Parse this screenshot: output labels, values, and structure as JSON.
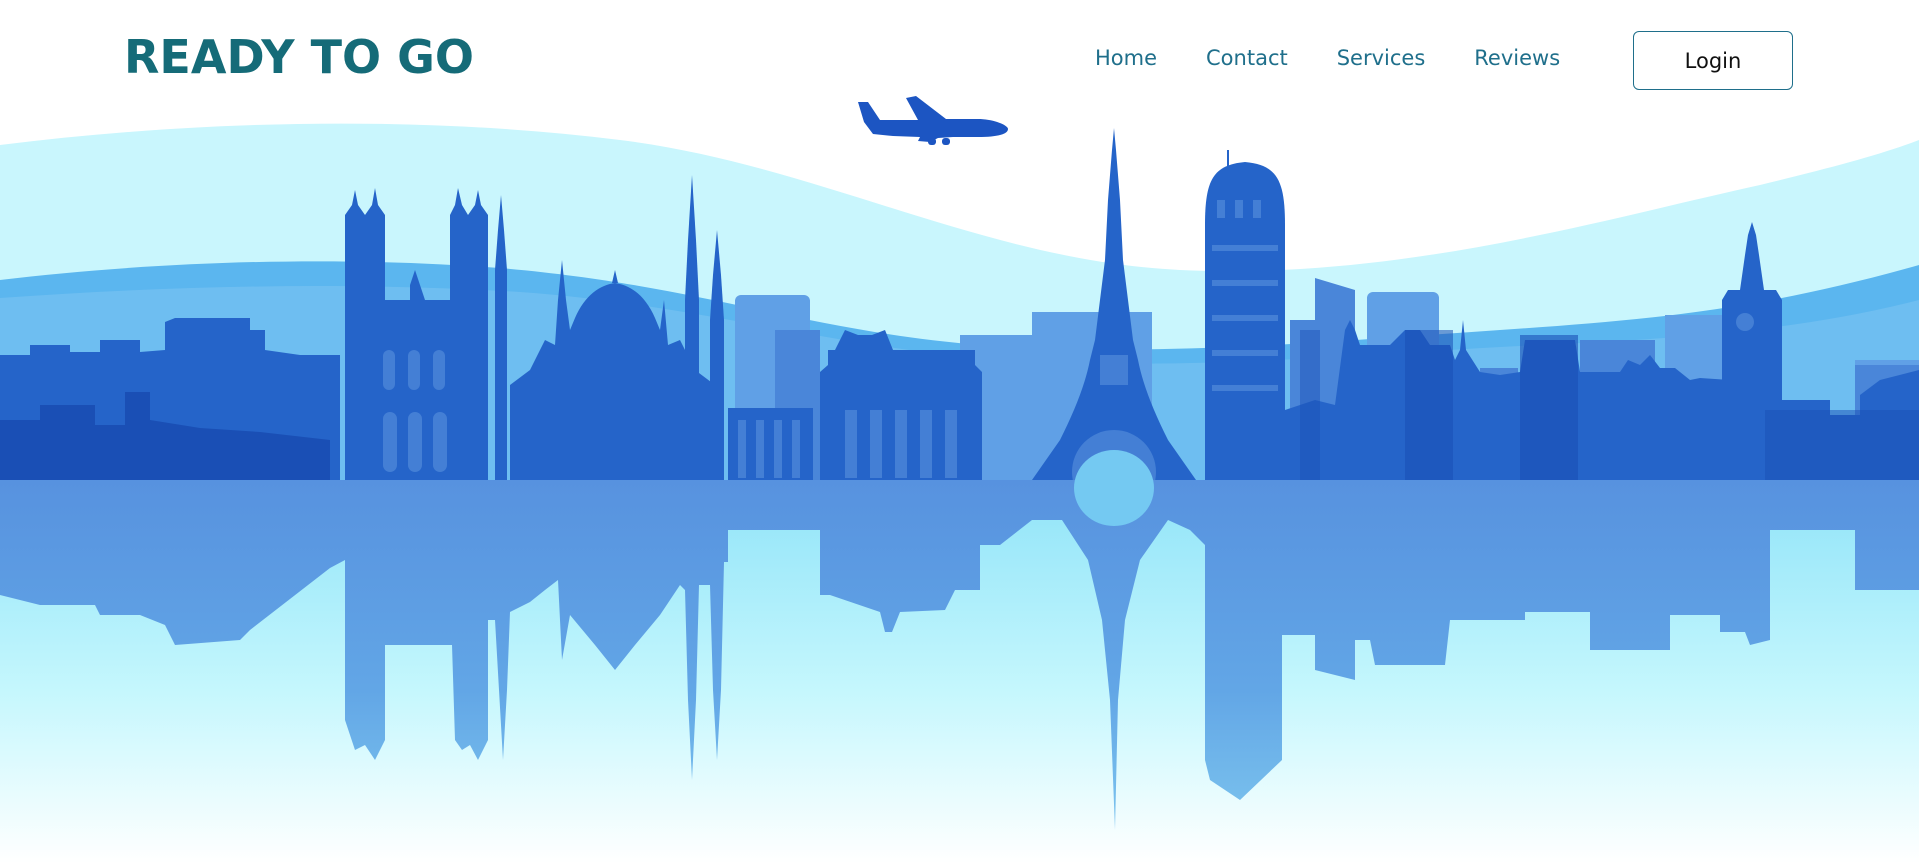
{
  "brand": {
    "logo_text": "READY TO GO"
  },
  "nav": {
    "items": [
      {
        "label": "Home"
      },
      {
        "label": "Contact"
      },
      {
        "label": "Services"
      },
      {
        "label": "Reviews"
      }
    ],
    "login_label": "Login"
  },
  "hero": {
    "image_description_icon": "city-skyline-icon",
    "landmark_icons": [
      "acropolis-icon",
      "notre-dame-icon",
      "mosque-icon",
      "brandenburg-gate-icon",
      "eiffel-tower-icon",
      "leaning-tower-icon",
      "big-ben-icon",
      "airplane-icon"
    ]
  },
  "colors": {
    "brand_teal": "#156b78",
    "nav_text": "#1f6f8b",
    "skyline_dark": "#1f5dc3",
    "skyline_mid": "#2f6fd0",
    "skyline_light": "#5f97e0",
    "water": "#bdf3fb",
    "sky_wave_light": "#c9f5fd",
    "sky_wave_mid": "#55b4ee",
    "reflection": "#5b94e0"
  }
}
